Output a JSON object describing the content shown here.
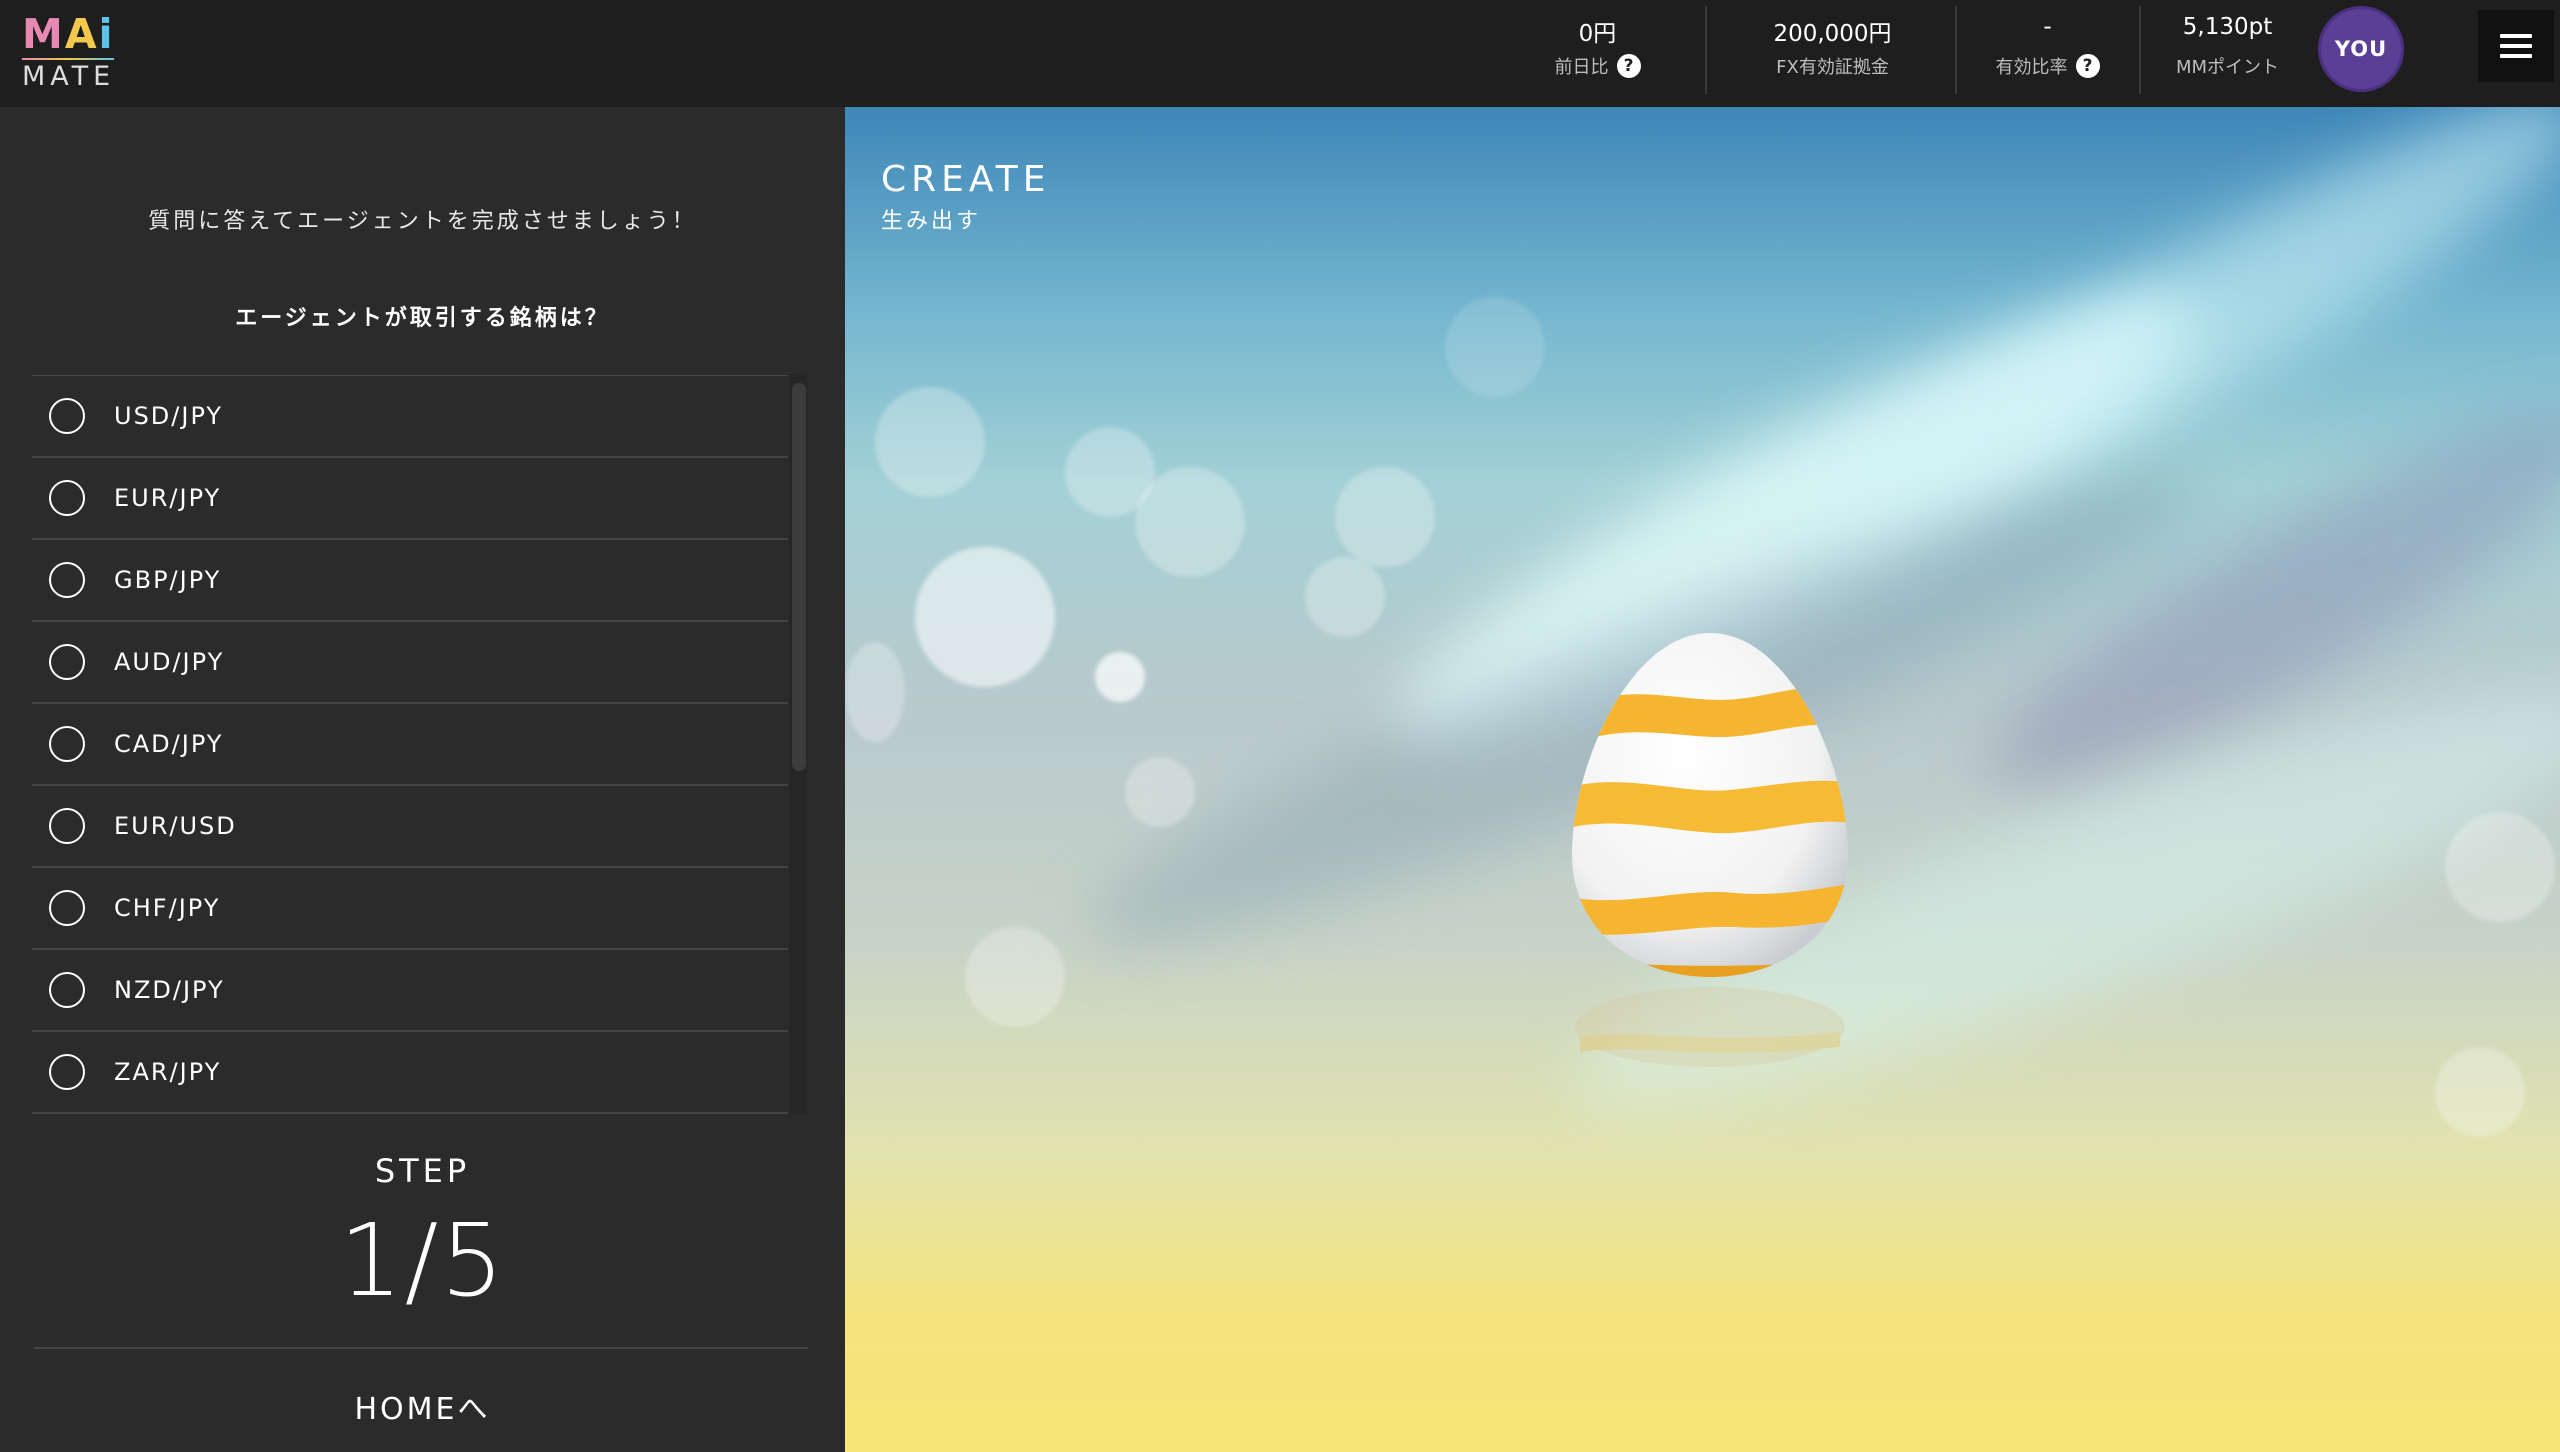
{
  "header": {
    "logo": {
      "top_letters": [
        "M",
        "A",
        "i"
      ],
      "bottom": "MATE"
    },
    "stats": [
      {
        "value": "0円",
        "label": "前日比",
        "has_help": true
      },
      {
        "value": "200,000円",
        "label": "FX有効証拠金",
        "has_help": false
      },
      {
        "value": "-",
        "label": "有効比率",
        "has_help": true
      },
      {
        "value": "5,130pt",
        "label": "MMポイント",
        "has_help": false
      }
    ],
    "help_glyph": "?",
    "user_badge": "YOU",
    "menu_icon": "hamburger-icon"
  },
  "left_panel": {
    "intro": "質問に答えてエージェントを完成させましょう！",
    "question": "エージェントが取引する銘柄は？",
    "options": [
      "USD/JPY",
      "EUR/JPY",
      "GBP/JPY",
      "AUD/JPY",
      "CAD/JPY",
      "EUR/USD",
      "CHF/JPY",
      "NZD/JPY",
      "ZAR/JPY"
    ],
    "step_label": "STEP",
    "step_value": "1/5",
    "home_link": "HOMEへ"
  },
  "scene": {
    "title": "CREATE",
    "subtitle": "生み出す"
  },
  "colors": {
    "header_bg": "#1e1e1e",
    "panel_bg": "#2b2b2b",
    "badge_purple": "#5b3f94",
    "egg_stripe": "#f5b530",
    "sky_top": "#3d86b8",
    "floor_yellow": "#f7e577"
  }
}
